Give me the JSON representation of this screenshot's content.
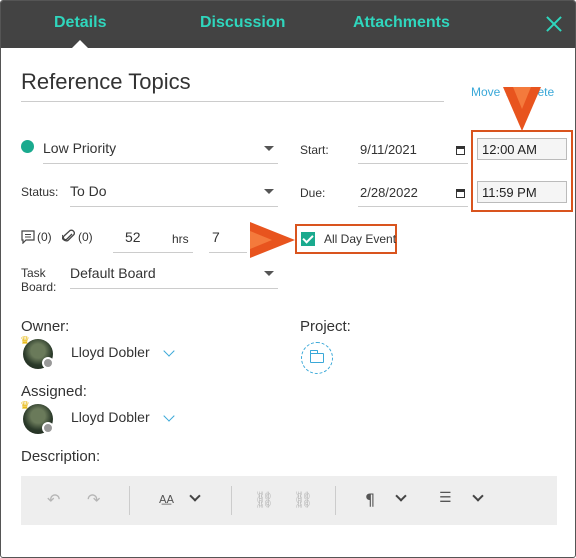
{
  "tabs": [
    "Details",
    "Discussion",
    "Attachments"
  ],
  "title": "Reference Topics",
  "actions": {
    "move_delete": "Move To Delete"
  },
  "priority": {
    "label": "Low Priority",
    "color": "#1aaa8e"
  },
  "status": {
    "label": "Status:",
    "value": "To Do"
  },
  "counts": {
    "comments": "(0)",
    "attachments": "(0)"
  },
  "hours": {
    "value": "52",
    "unit": "hrs",
    "minutes": "7"
  },
  "task_board": {
    "label": "Task Board:",
    "value": "Default Board"
  },
  "start": {
    "label": "Start:",
    "date": "9/11/2021",
    "time": "12:00 AM"
  },
  "due": {
    "label": "Due:",
    "date": "2/28/2022",
    "time": "11:59 PM"
  },
  "all_day": {
    "label": "All Day Event",
    "checked": true
  },
  "owner": {
    "label": "Owner:",
    "name": "Lloyd Dobler"
  },
  "assigned": {
    "label": "Assigned:",
    "name": "Lloyd Dobler"
  },
  "project": {
    "label": "Project:"
  },
  "description": {
    "label": "Description:"
  },
  "colors": {
    "accent": "#2fd6bd",
    "header_bg": "#434343",
    "link": "#3aa8d8",
    "highlight": "#d9541e"
  },
  "icons": [
    "close-icon",
    "calendar-icon",
    "comment-icon",
    "paperclip-icon",
    "crown-icon",
    "folder-icon",
    "undo-icon",
    "redo-icon",
    "font-size-icon",
    "link-icon",
    "unlink-icon",
    "paragraph-icon",
    "list-icon",
    "chevron-down-icon",
    "arrow-pointer-icon"
  ]
}
